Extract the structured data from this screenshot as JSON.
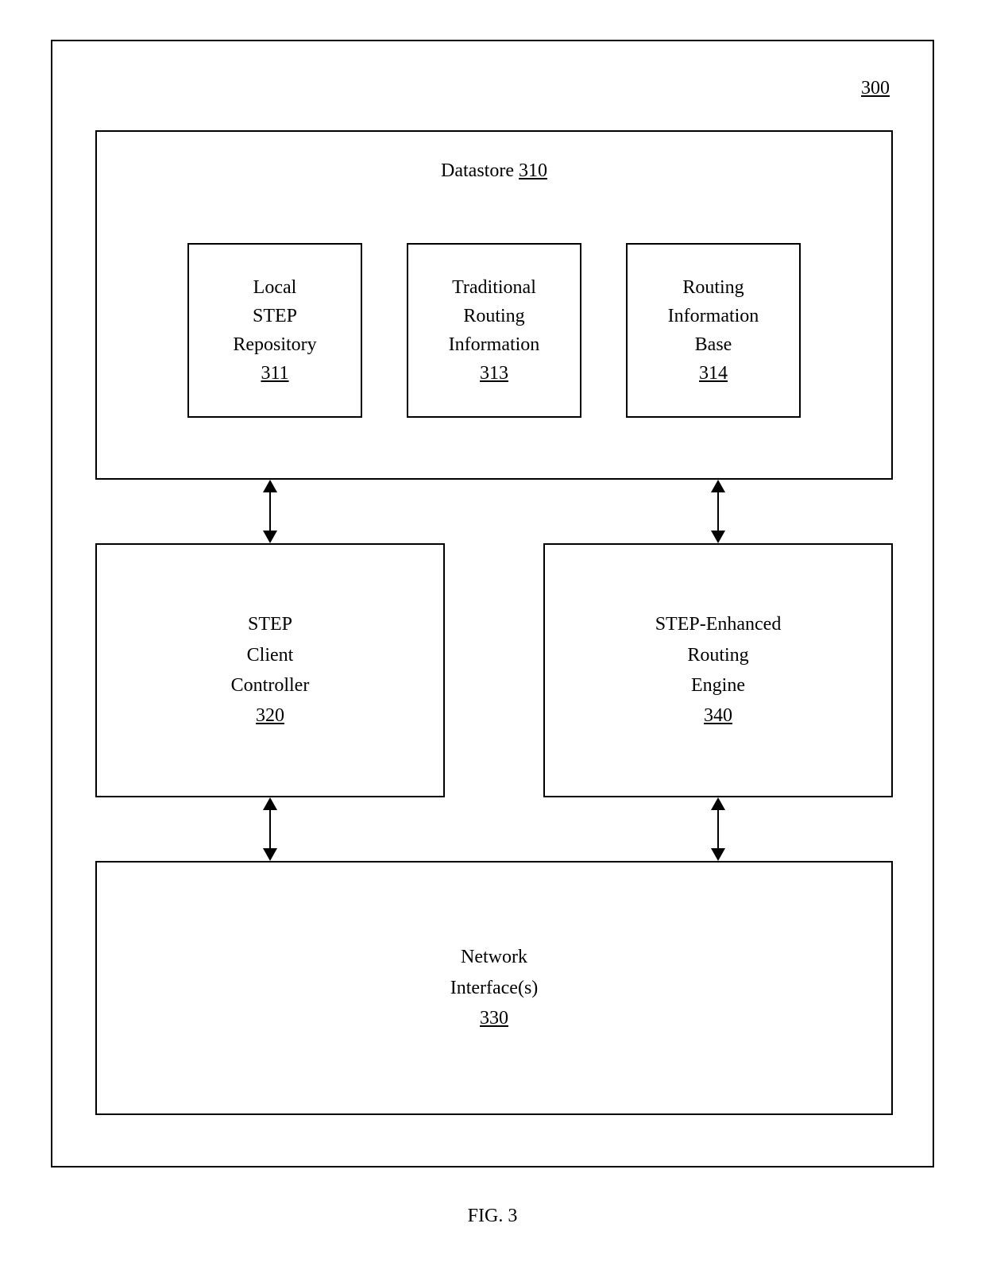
{
  "figure": {
    "caption": "FIG. 3",
    "ref_outer": "300"
  },
  "datastore": {
    "title_text": "Datastore ",
    "title_ref": "310",
    "boxes": [
      {
        "l1": "Local",
        "l2": "STEP",
        "l3": "Repository",
        "ref": "311"
      },
      {
        "l1": "Traditional",
        "l2": "Routing",
        "l3": "Information",
        "ref": "313"
      },
      {
        "l1": "Routing",
        "l2": "Information",
        "l3": "Base",
        "ref": "314"
      }
    ]
  },
  "mid": {
    "left": {
      "l1": "STEP",
      "l2": "Client",
      "l3": "Controller",
      "ref": "320"
    },
    "right": {
      "l1": "STEP-Enhanced",
      "l2": "Routing",
      "l3": "Engine",
      "ref": "340"
    }
  },
  "net": {
    "l1": "Network",
    "l2": "Interface(s)",
    "ref": "330"
  }
}
